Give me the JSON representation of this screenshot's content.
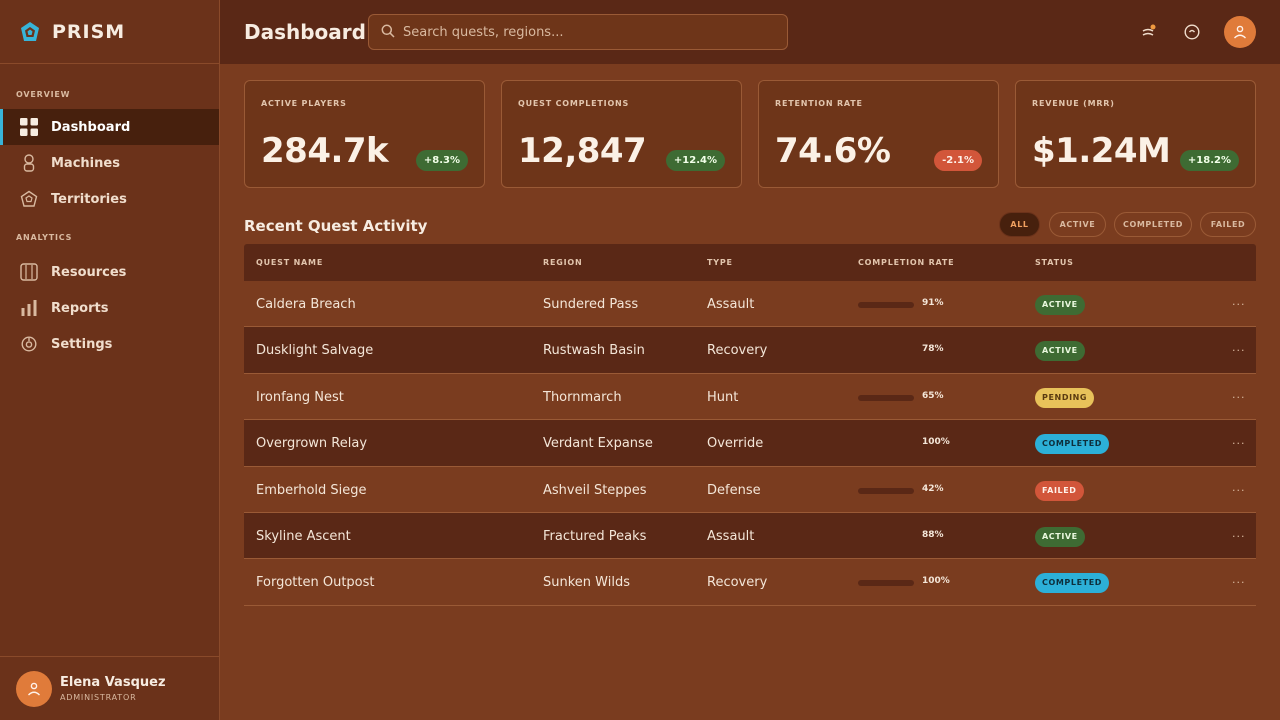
{
  "brand": {
    "name": "PRISM"
  },
  "sidebar": {
    "sections": [
      {
        "title": "OVERVIEW"
      },
      {
        "title": "ANALYTICS"
      }
    ],
    "items": [
      {
        "label": "Dashboard",
        "icon": "grid-icon"
      },
      {
        "label": "Machines",
        "icon": "robot-icon"
      },
      {
        "label": "Territories",
        "icon": "pentagon-icon"
      },
      {
        "label": "Resources",
        "icon": "panel-icon"
      },
      {
        "label": "Reports",
        "icon": "bars-icon"
      },
      {
        "label": "Settings",
        "icon": "gear-icon"
      }
    ],
    "user": {
      "name": "Elena Vasquez",
      "role": "ADMINISTRATOR"
    }
  },
  "header": {
    "title": "Dashboard",
    "search_placeholder": "Search quests, regions..."
  },
  "stats": [
    {
      "label": "ACTIVE PLAYERS",
      "value": "284.7k",
      "change": "+8.3%",
      "trend": "up"
    },
    {
      "label": "QUEST COMPLETIONS",
      "value": "12,847",
      "change": "+12.4%",
      "trend": "up"
    },
    {
      "label": "RETENTION RATE",
      "value": "74.6%",
      "change": "-2.1%",
      "trend": "down"
    },
    {
      "label": "REVENUE (MRR)",
      "value": "$1.24M",
      "change": "+18.2%",
      "trend": "up"
    }
  ],
  "activity": {
    "title": "Recent Quest Activity",
    "filters": [
      "ALL",
      "ACTIVE",
      "COMPLETED",
      "FAILED"
    ],
    "active_filter": "ALL",
    "columns": [
      "QUEST NAME",
      "REGION",
      "TYPE",
      "COMPLETION RATE",
      "STATUS"
    ],
    "rows": [
      {
        "name": "Caldera Breach",
        "region": "Sundered Pass",
        "type": "Assault",
        "rate": "91%",
        "status": "ACTIVE"
      },
      {
        "name": "Dusklight Salvage",
        "region": "Rustwash Basin",
        "type": "Recovery",
        "rate": "78%",
        "status": "ACTIVE"
      },
      {
        "name": "Ironfang Nest",
        "region": "Thornmarch",
        "type": "Hunt",
        "rate": "65%",
        "status": "PENDING"
      },
      {
        "name": "Overgrown Relay",
        "region": "Verdant Expanse",
        "type": "Override",
        "rate": "100%",
        "status": "COMPLETED"
      },
      {
        "name": "Emberhold Siege",
        "region": "Ashveil Steppes",
        "type": "Defense",
        "rate": "42%",
        "status": "FAILED"
      },
      {
        "name": "Skyline Ascent",
        "region": "Fractured Peaks",
        "type": "Assault",
        "rate": "88%",
        "status": "ACTIVE"
      },
      {
        "name": "Forgotten Outpost",
        "region": "Sunken Wilds",
        "type": "Recovery",
        "rate": "100%",
        "status": "COMPLETED"
      }
    ],
    "row_action": "..."
  },
  "colors": {
    "accent": "#38b4d8",
    "brand_orange": "#e07b3a",
    "status_active": "#3e6b33",
    "status_pending": "#e8c25a",
    "status_completed": "#2cb0d8",
    "status_failed": "#d2563a"
  }
}
